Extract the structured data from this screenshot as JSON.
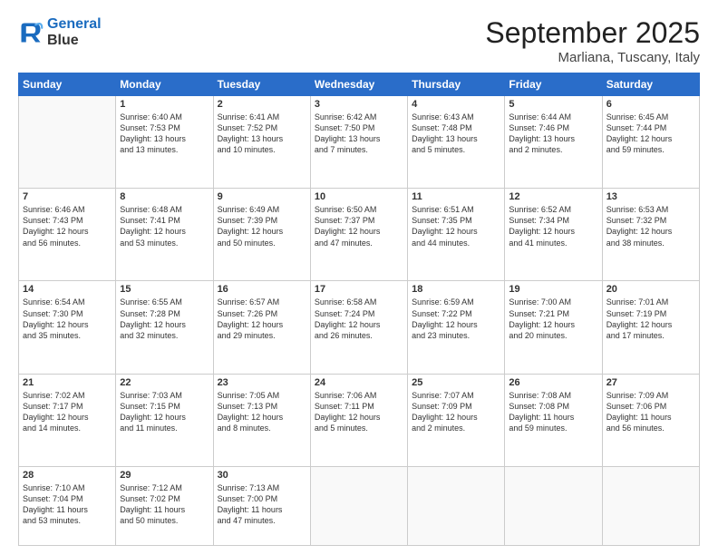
{
  "logo": {
    "line1": "General",
    "line2": "Blue"
  },
  "title": "September 2025",
  "subtitle": "Marliana, Tuscany, Italy",
  "weekdays": [
    "Sunday",
    "Monday",
    "Tuesday",
    "Wednesday",
    "Thursday",
    "Friday",
    "Saturday"
  ],
  "weeks": [
    [
      {
        "day": "",
        "content": ""
      },
      {
        "day": "1",
        "content": "Sunrise: 6:40 AM\nSunset: 7:53 PM\nDaylight: 13 hours\nand 13 minutes."
      },
      {
        "day": "2",
        "content": "Sunrise: 6:41 AM\nSunset: 7:52 PM\nDaylight: 13 hours\nand 10 minutes."
      },
      {
        "day": "3",
        "content": "Sunrise: 6:42 AM\nSunset: 7:50 PM\nDaylight: 13 hours\nand 7 minutes."
      },
      {
        "day": "4",
        "content": "Sunrise: 6:43 AM\nSunset: 7:48 PM\nDaylight: 13 hours\nand 5 minutes."
      },
      {
        "day": "5",
        "content": "Sunrise: 6:44 AM\nSunset: 7:46 PM\nDaylight: 13 hours\nand 2 minutes."
      },
      {
        "day": "6",
        "content": "Sunrise: 6:45 AM\nSunset: 7:44 PM\nDaylight: 12 hours\nand 59 minutes."
      }
    ],
    [
      {
        "day": "7",
        "content": "Sunrise: 6:46 AM\nSunset: 7:43 PM\nDaylight: 12 hours\nand 56 minutes."
      },
      {
        "day": "8",
        "content": "Sunrise: 6:48 AM\nSunset: 7:41 PM\nDaylight: 12 hours\nand 53 minutes."
      },
      {
        "day": "9",
        "content": "Sunrise: 6:49 AM\nSunset: 7:39 PM\nDaylight: 12 hours\nand 50 minutes."
      },
      {
        "day": "10",
        "content": "Sunrise: 6:50 AM\nSunset: 7:37 PM\nDaylight: 12 hours\nand 47 minutes."
      },
      {
        "day": "11",
        "content": "Sunrise: 6:51 AM\nSunset: 7:35 PM\nDaylight: 12 hours\nand 44 minutes."
      },
      {
        "day": "12",
        "content": "Sunrise: 6:52 AM\nSunset: 7:34 PM\nDaylight: 12 hours\nand 41 minutes."
      },
      {
        "day": "13",
        "content": "Sunrise: 6:53 AM\nSunset: 7:32 PM\nDaylight: 12 hours\nand 38 minutes."
      }
    ],
    [
      {
        "day": "14",
        "content": "Sunrise: 6:54 AM\nSunset: 7:30 PM\nDaylight: 12 hours\nand 35 minutes."
      },
      {
        "day": "15",
        "content": "Sunrise: 6:55 AM\nSunset: 7:28 PM\nDaylight: 12 hours\nand 32 minutes."
      },
      {
        "day": "16",
        "content": "Sunrise: 6:57 AM\nSunset: 7:26 PM\nDaylight: 12 hours\nand 29 minutes."
      },
      {
        "day": "17",
        "content": "Sunrise: 6:58 AM\nSunset: 7:24 PM\nDaylight: 12 hours\nand 26 minutes."
      },
      {
        "day": "18",
        "content": "Sunrise: 6:59 AM\nSunset: 7:22 PM\nDaylight: 12 hours\nand 23 minutes."
      },
      {
        "day": "19",
        "content": "Sunrise: 7:00 AM\nSunset: 7:21 PM\nDaylight: 12 hours\nand 20 minutes."
      },
      {
        "day": "20",
        "content": "Sunrise: 7:01 AM\nSunset: 7:19 PM\nDaylight: 12 hours\nand 17 minutes."
      }
    ],
    [
      {
        "day": "21",
        "content": "Sunrise: 7:02 AM\nSunset: 7:17 PM\nDaylight: 12 hours\nand 14 minutes."
      },
      {
        "day": "22",
        "content": "Sunrise: 7:03 AM\nSunset: 7:15 PM\nDaylight: 12 hours\nand 11 minutes."
      },
      {
        "day": "23",
        "content": "Sunrise: 7:05 AM\nSunset: 7:13 PM\nDaylight: 12 hours\nand 8 minutes."
      },
      {
        "day": "24",
        "content": "Sunrise: 7:06 AM\nSunset: 7:11 PM\nDaylight: 12 hours\nand 5 minutes."
      },
      {
        "day": "25",
        "content": "Sunrise: 7:07 AM\nSunset: 7:09 PM\nDaylight: 12 hours\nand 2 minutes."
      },
      {
        "day": "26",
        "content": "Sunrise: 7:08 AM\nSunset: 7:08 PM\nDaylight: 11 hours\nand 59 minutes."
      },
      {
        "day": "27",
        "content": "Sunrise: 7:09 AM\nSunset: 7:06 PM\nDaylight: 11 hours\nand 56 minutes."
      }
    ],
    [
      {
        "day": "28",
        "content": "Sunrise: 7:10 AM\nSunset: 7:04 PM\nDaylight: 11 hours\nand 53 minutes."
      },
      {
        "day": "29",
        "content": "Sunrise: 7:12 AM\nSunset: 7:02 PM\nDaylight: 11 hours\nand 50 minutes."
      },
      {
        "day": "30",
        "content": "Sunrise: 7:13 AM\nSunset: 7:00 PM\nDaylight: 11 hours\nand 47 minutes."
      },
      {
        "day": "",
        "content": ""
      },
      {
        "day": "",
        "content": ""
      },
      {
        "day": "",
        "content": ""
      },
      {
        "day": "",
        "content": ""
      }
    ]
  ]
}
